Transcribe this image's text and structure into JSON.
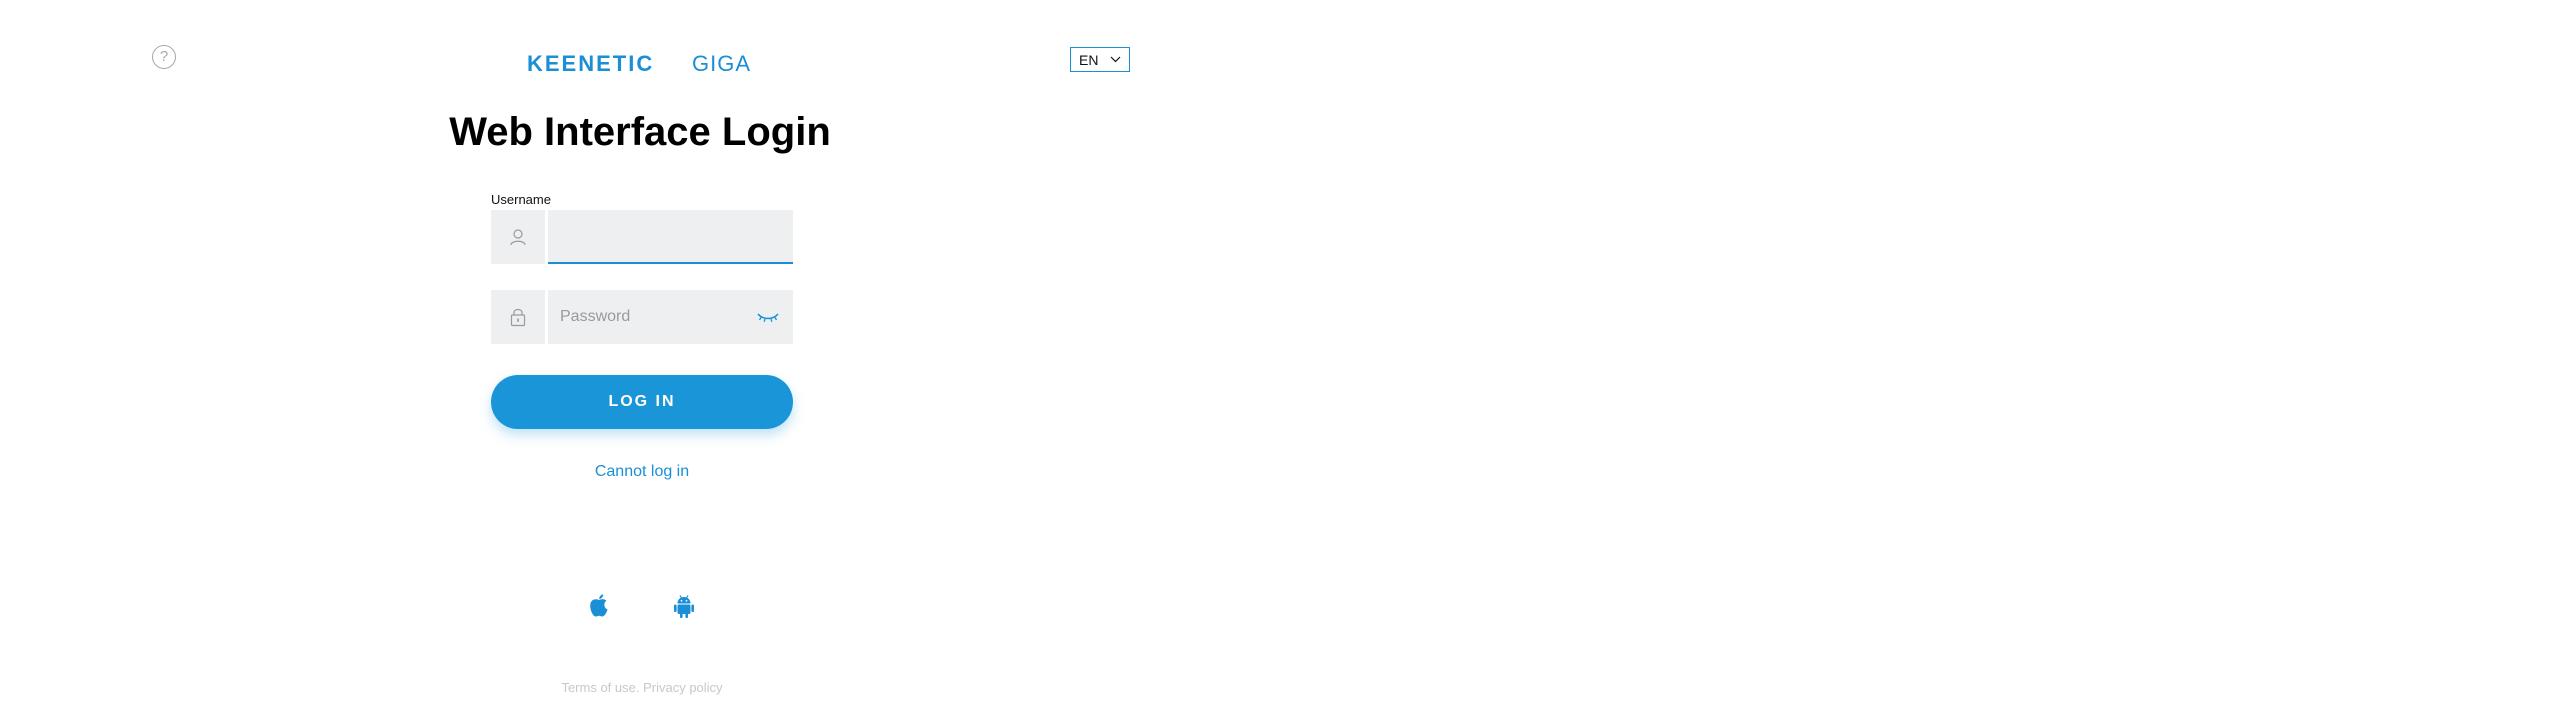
{
  "header": {
    "help_label": "?",
    "logo_brand": "KEENETIC",
    "logo_model": "GIGA",
    "language": "EN"
  },
  "login": {
    "title": "Web Interface Login",
    "username_label": "Username",
    "username_value": "",
    "password_placeholder": "Password",
    "login_button": "LOG IN",
    "cannot_login": "Cannot log in"
  },
  "footer": {
    "terms": "Terms of use.",
    "privacy": "Privacy policy"
  },
  "colors": {
    "accent": "#1a96d8",
    "field_bg": "#eeeff1",
    "footer_text": "#c8c8c8"
  },
  "icons": [
    "help-icon",
    "user-icon",
    "lock-icon",
    "eye-icon",
    "chevron-down-icon",
    "apple-icon",
    "android-icon"
  ]
}
